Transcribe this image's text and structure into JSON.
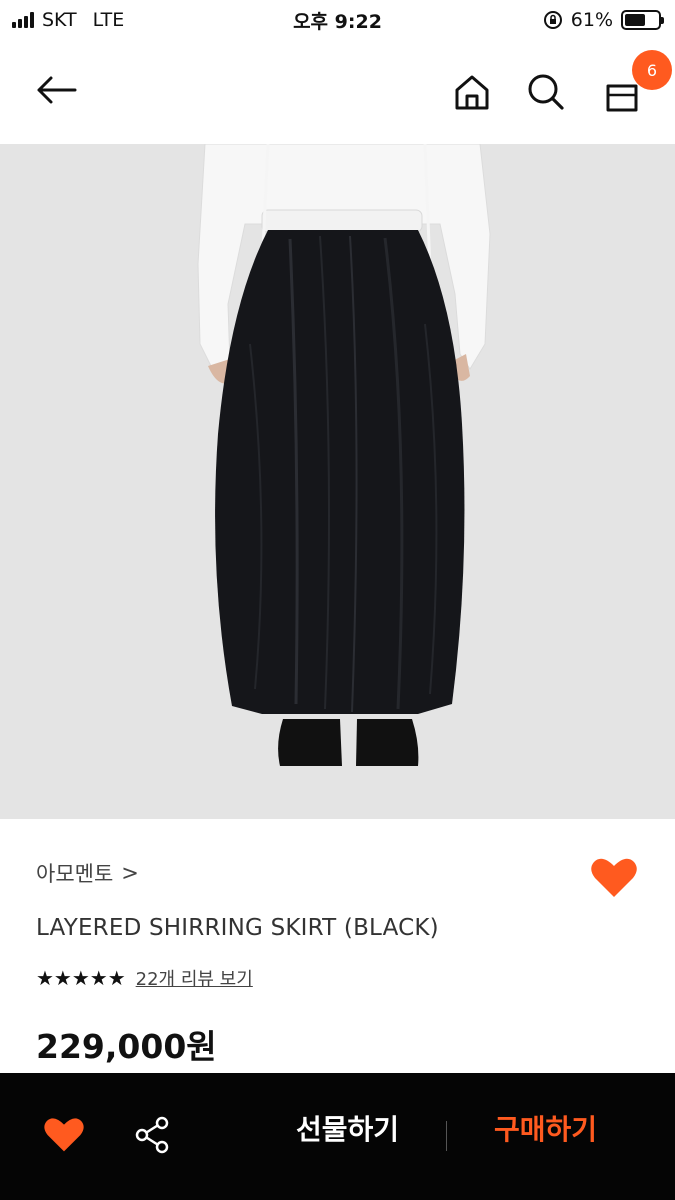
{
  "status_bar": {
    "carrier": "SKT",
    "network": "LTE",
    "time": "오후 9:22",
    "battery_percent": "61%",
    "battery_level": 0.61,
    "icons": [
      "signal-icon",
      "rotation-lock-icon",
      "battery-icon"
    ]
  },
  "nav": {
    "icons": [
      "back-arrow-icon",
      "home-icon",
      "search-icon",
      "shopping-bag-icon"
    ],
    "cart_count": "6"
  },
  "product": {
    "brand": "아모멘토",
    "brand_chevron": ">",
    "title": "LAYERED SHIRRING SKIRT (BLACK)",
    "stars": "★★★★★",
    "rating": 5,
    "review_link": "22개 리뷰 보기",
    "price": "229,000원"
  },
  "bottom_bar": {
    "icons": [
      "heart-icon",
      "share-icon"
    ],
    "gift_label": "선물하기",
    "buy_label": "구매하기"
  },
  "colors": {
    "accent": "#ff5a1f",
    "bottom_bar_bg": "#050505",
    "image_bg": "#e4e4e4"
  }
}
